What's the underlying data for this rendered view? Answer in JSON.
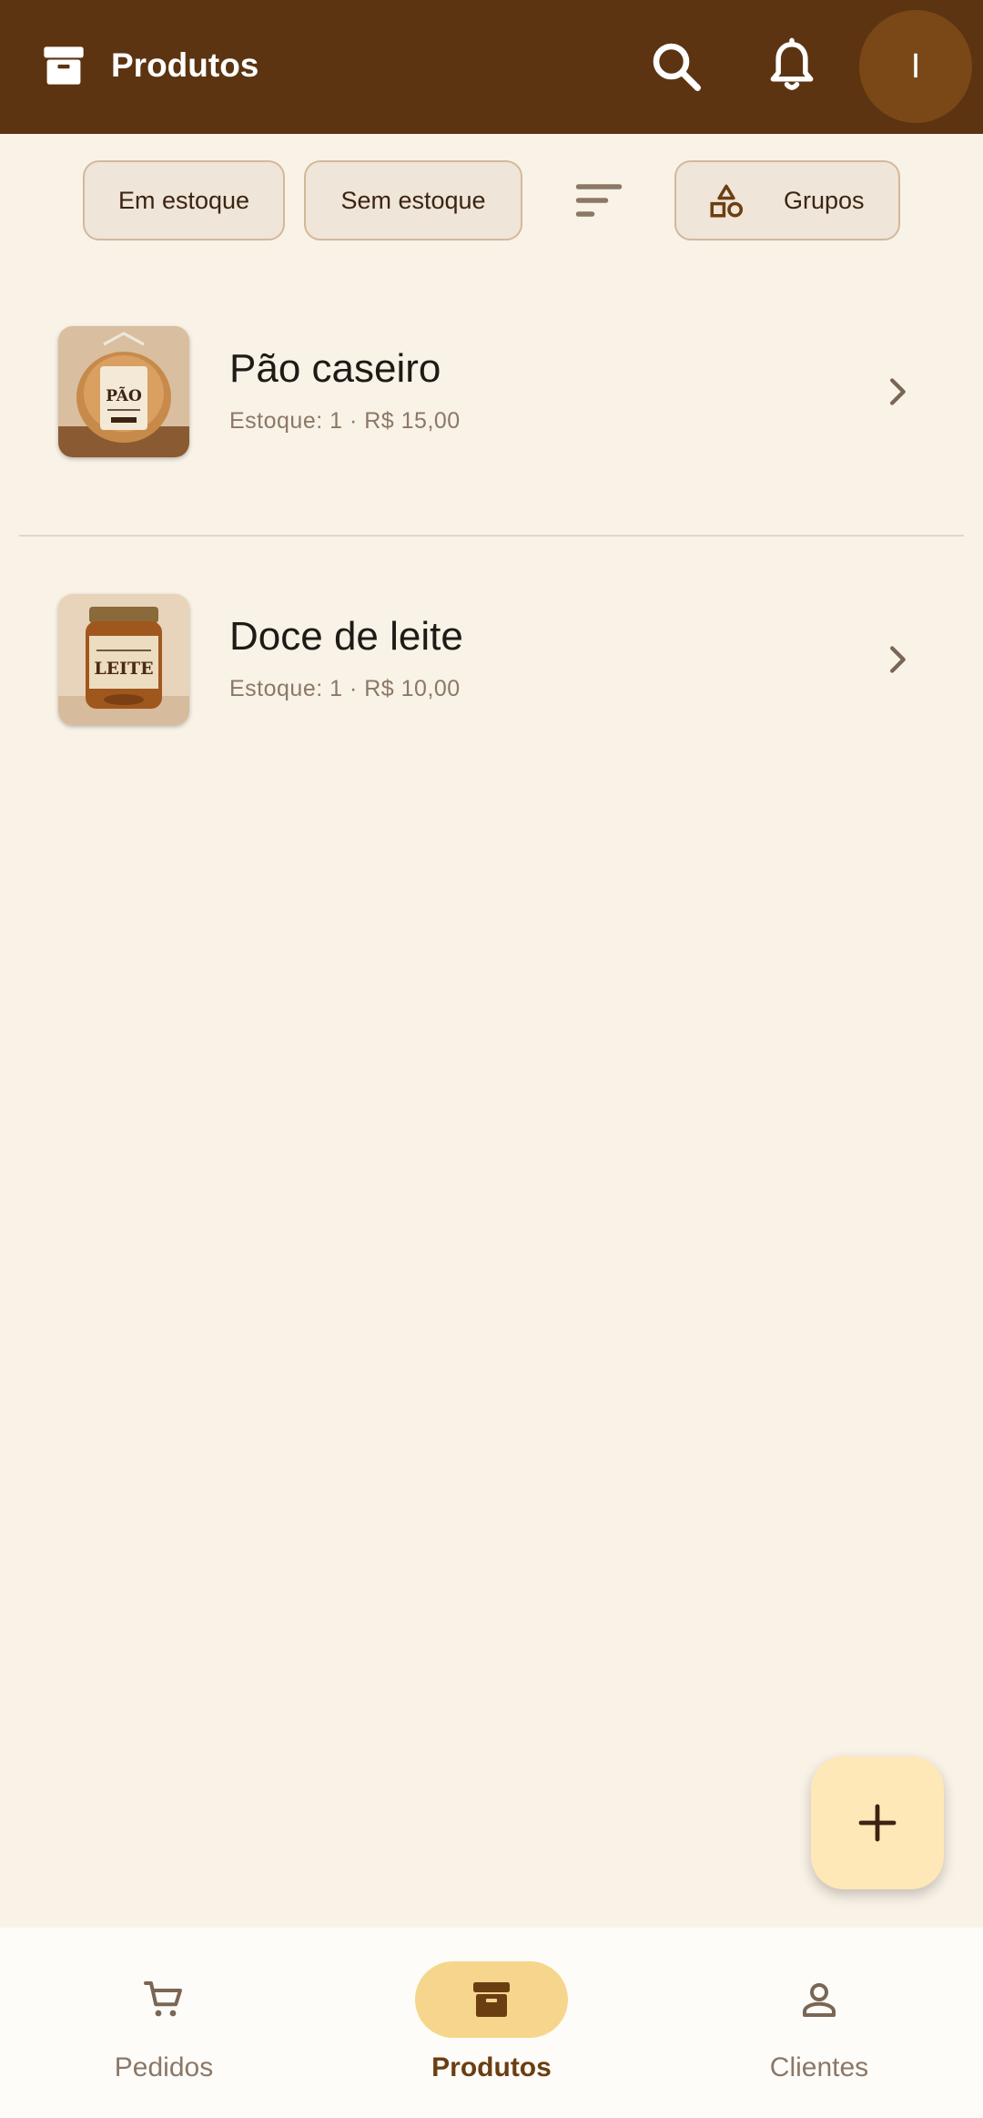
{
  "app_bar": {
    "title": "Produtos",
    "avatar_initial": "I"
  },
  "filters": {
    "in_stock": "Em estoque",
    "out_of_stock": "Sem estoque",
    "groups": "Grupos"
  },
  "products": [
    {
      "name": "Pão caseiro",
      "subtitle": "Estoque: 1 · R$ 15,00",
      "image_label": "PÃO"
    },
    {
      "name": "Doce de leite",
      "subtitle": "Estoque: 1 · R$ 10,00",
      "image_label": "LEITE"
    }
  ],
  "bottom_nav": {
    "items": [
      {
        "label": "Pedidos",
        "icon": "cart-icon"
      },
      {
        "label": "Produtos",
        "icon": "archive-icon",
        "active": true
      },
      {
        "label": "Clientes",
        "icon": "person-icon"
      }
    ]
  },
  "colors": {
    "app_bar": "#5c3411",
    "background": "#f9f2e7",
    "active_pill": "#f5d68c",
    "fab": "#ffe8b8"
  }
}
